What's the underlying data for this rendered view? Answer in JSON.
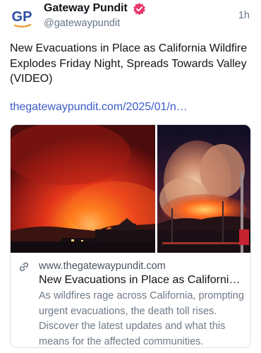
{
  "post": {
    "author": {
      "display_name": "Gateway Pundit",
      "handle": "@gatewaypundit",
      "avatar_initials": "GP",
      "verified_icon": "verified-badge-icon",
      "verified_color": "#e8396b"
    },
    "timestamp": "1h",
    "text": "New Evacuations in Place as California Wildfire Explodes Friday Night, Spreads Towards Valley (VIDEO)",
    "link_text": "thegatewaypundit.com/2025/01/n…",
    "link_color": "#3a5bc7"
  },
  "link_card": {
    "icon": "link-icon",
    "domain": "www.thegatewaypundit.com",
    "title": "New Evacuations in Place as Californi…",
    "description": "As wildfires rage across California, prompting urgent evacuations, the death toll rises. Discover the latest updates and what this means for the affected communities."
  }
}
